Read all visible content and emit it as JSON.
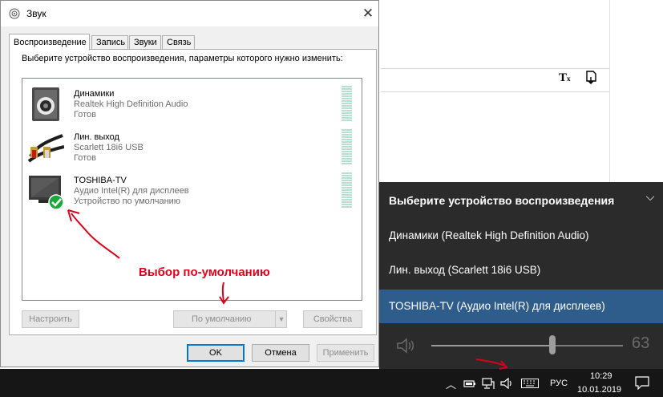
{
  "dialog": {
    "title": "Звук",
    "tabs": [
      "Воспроизведение",
      "Запись",
      "Звуки",
      "Связь"
    ],
    "instruction": "Выберите устройство воспроизведения, параметры которого нужно изменить:",
    "devices": [
      {
        "name": "Динамики",
        "driver": "Realtek High Definition Audio",
        "status": "Готов",
        "icon": "speaker-icon"
      },
      {
        "name": "Лин. выход",
        "driver": "Scarlett 18i6 USB",
        "status": "Готов",
        "icon": "rca-cable-icon"
      },
      {
        "name": "TOSHIBA-TV",
        "driver": "Аудио Intel(R) для дисплеев",
        "status": "Устройство по умолчанию",
        "icon": "tv-monitor-icon",
        "default": true
      }
    ],
    "buttons": {
      "configure": "Настроить",
      "set_default": "По умолчанию",
      "properties": "Свойства",
      "ok": "OK",
      "cancel": "Отмена",
      "apply": "Применить"
    }
  },
  "annotation": {
    "text": "Выбор по-умолчанию",
    "color": "#e0001c"
  },
  "flyout": {
    "header": "Выберите устройство воспроизведения",
    "items": [
      "Динамики (Realtek High Definition Audio)",
      "Лин. выход (Scarlett 18i6 USB)",
      "TOSHIBA-TV (Аудио Intel(R) для дисплеев)"
    ],
    "selected_index": 2,
    "volume": 63,
    "volume_text": "63"
  },
  "taskbar": {
    "language": "РУС",
    "time": "10:29",
    "date": "10.01.2019"
  },
  "colors": {
    "flyout_bg": "#2b2b2b",
    "flyout_selected": "#2e5d8c",
    "taskbar_bg": "#161616",
    "check_green": "#1aa83a"
  }
}
